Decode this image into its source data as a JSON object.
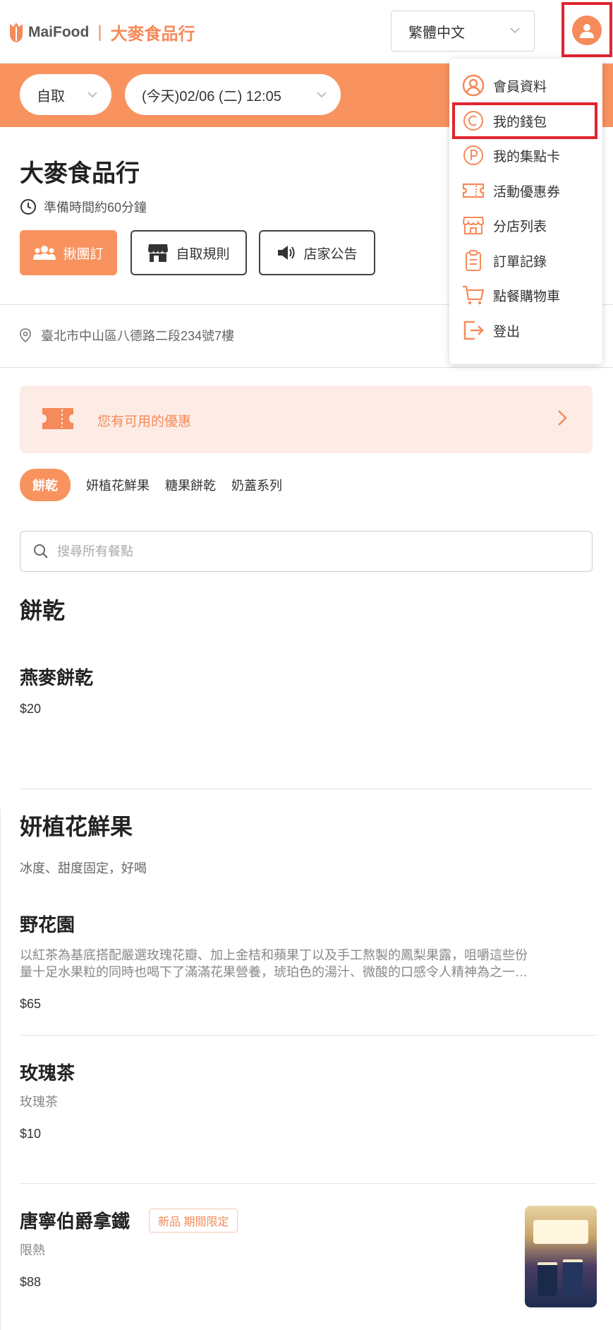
{
  "header": {
    "brand": "MaiFood",
    "separator": "|",
    "shop_name": "大麥食品行",
    "language": "繁體中文"
  },
  "order_bar": {
    "mode": "自取",
    "pickup_time": "(今天)02/06 (二) 12:05"
  },
  "store": {
    "name": "大麥食品行",
    "prep_time": "準備時間約60分鐘",
    "buttons": {
      "group_order": "揪團訂",
      "pickup_rules": "自取規則",
      "announcement": "店家公告"
    },
    "address": "臺北市中山區八德路二段234號7樓"
  },
  "promo": {
    "text": "您有可用的優惠"
  },
  "categories": [
    "餅乾",
    "妍植花鮮果",
    "糖果餅乾",
    "奶蓋系列"
  ],
  "search": {
    "placeholder": "搜尋所有餐點"
  },
  "sections": {
    "cookies": {
      "title": "餅乾",
      "items": [
        {
          "name": "燕麥餅乾",
          "price": "$20"
        }
      ]
    },
    "fruit": {
      "title": "妍植花鮮果",
      "description": "冰度、甜度固定，好喝",
      "items": [
        {
          "name": "野花園",
          "description_line1": "以紅茶為基底搭配嚴選玫瑰花瓣、加上金桔和蘋果丁以及手工熬製的鳳梨果露，咀嚼這些份",
          "description_line2": "量十足水果粒的同時也喝下了滿滿花果營養，琥珀色的湯汁、微酸的口感令人精神為之一…",
          "price": "$65"
        },
        {
          "name": "玫瑰茶",
          "description": "玫瑰茶",
          "price": "$10"
        },
        {
          "name": "唐寧伯爵拿鐵",
          "badge": "新品 期間限定",
          "description": "限熱",
          "price": "$88"
        }
      ]
    }
  },
  "user_menu": {
    "items": [
      {
        "label": "會員資料",
        "icon": "user-circle-icon"
      },
      {
        "label": "我的錢包",
        "icon": "wallet-coin-icon"
      },
      {
        "label": "我的集點卡",
        "icon": "points-card-icon"
      },
      {
        "label": "活動優惠券",
        "icon": "coupon-icon"
      },
      {
        "label": "分店列表",
        "icon": "store-icon"
      },
      {
        "label": "訂單記錄",
        "icon": "clipboard-icon"
      },
      {
        "label": "點餐購物車",
        "icon": "cart-icon"
      },
      {
        "label": "登出",
        "icon": "logout-icon"
      }
    ]
  },
  "colors": {
    "accent": "#f8935f",
    "highlight_box": "#e0242f"
  }
}
